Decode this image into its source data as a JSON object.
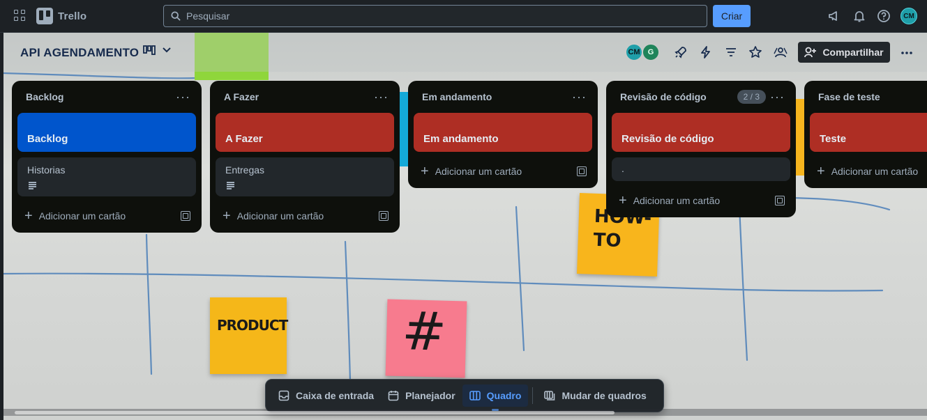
{
  "app": {
    "name": "Trello",
    "search_placeholder": "Pesquisar",
    "create_label": "Criar",
    "user_initials": "CM"
  },
  "board": {
    "title": "API AGENDAMENTO",
    "members": [
      {
        "initials": "CM",
        "color": "#1f9fa9"
      },
      {
        "initials": "G",
        "color": "#1f845a"
      }
    ],
    "share_label": "Compartilhar"
  },
  "lists": [
    {
      "title": "Backlog",
      "cover": {
        "label": "Backlog",
        "color": "#0055cc"
      },
      "cards": [
        {
          "title": "Historias",
          "has_description": true
        }
      ],
      "add_label": "Adicionar um cartão"
    },
    {
      "title": "A Fazer",
      "cover": {
        "label": "A Fazer",
        "color": "#ae2e24"
      },
      "cards": [
        {
          "title": "Entregas",
          "has_description": true
        }
      ],
      "add_label": "Adicionar um cartão"
    },
    {
      "title": "Em andamento",
      "cover": {
        "label": "Em andamento",
        "color": "#ae2e24"
      },
      "cards": [],
      "add_label": "Adicionar um cartão"
    },
    {
      "title": "Revisão de código",
      "badge": "2 / 3",
      "cover": {
        "label": "Revisão de código",
        "color": "#ae2e24"
      },
      "cards": [
        {
          "title": ".",
          "has_description": false
        }
      ],
      "add_label": "Adicionar um cartão"
    },
    {
      "title": "Fase de teste",
      "cover": {
        "label": "Teste",
        "color": "#ae2e24"
      },
      "cards": [],
      "add_label": "Adicionar um cartão"
    }
  ],
  "stickies": {
    "how_to": "HOW-\nTO",
    "product": "PRODUCT",
    "hash": "#"
  },
  "bottom_nav": {
    "inbox": "Caixa de entrada",
    "planner": "Planejador",
    "board": "Quadro",
    "switch": "Mudar de quadros"
  }
}
